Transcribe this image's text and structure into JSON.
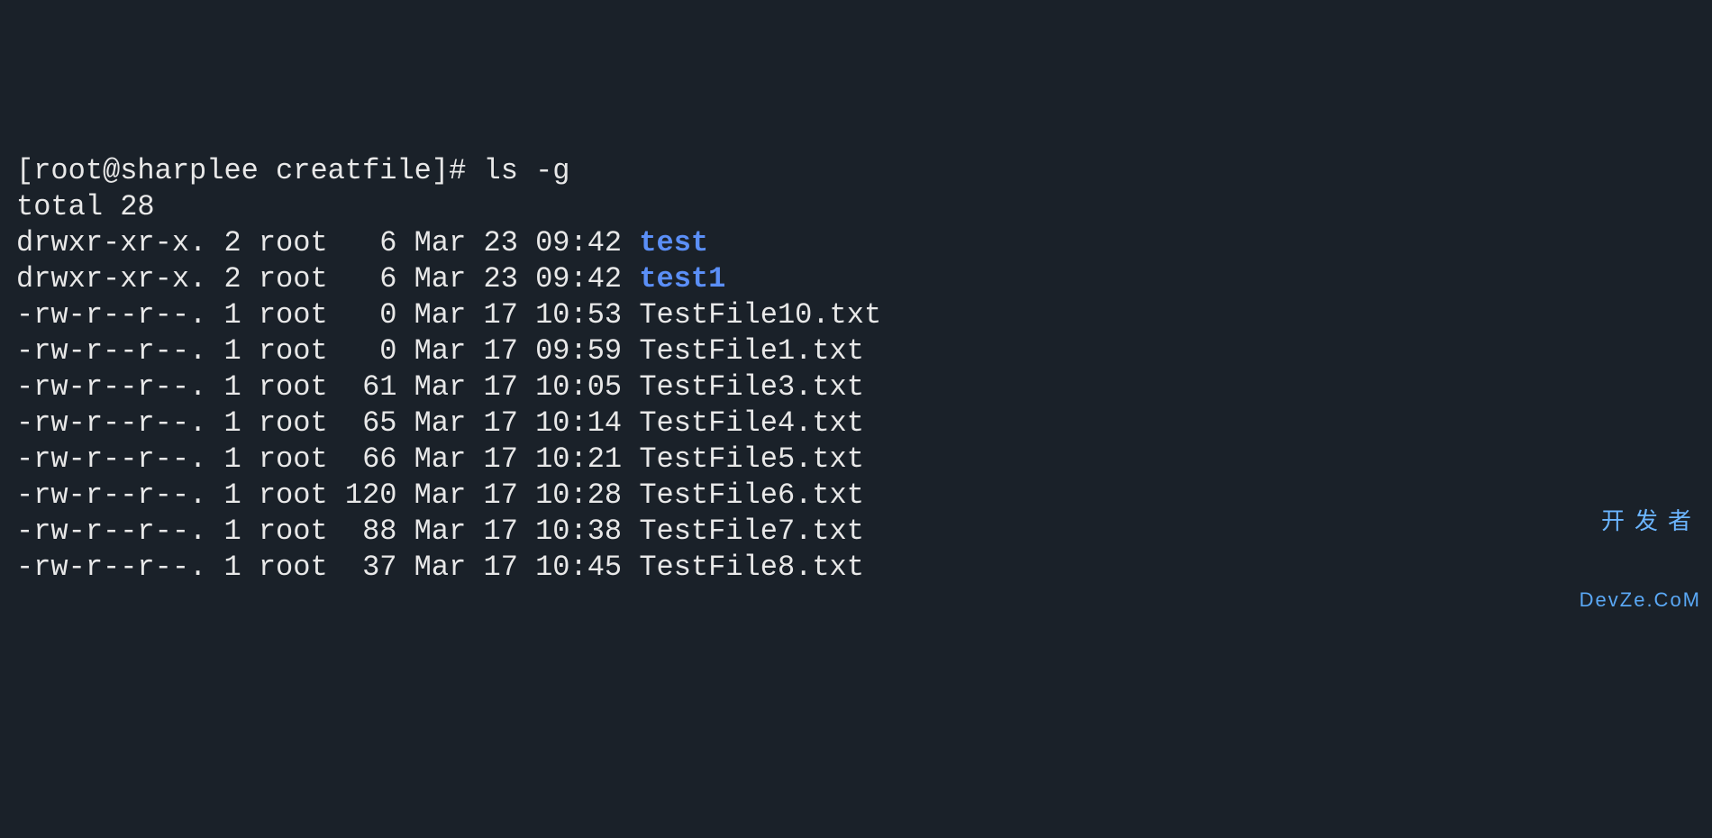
{
  "prompt": {
    "user_host": "root@sharplee",
    "cwd": "creatfile",
    "symbol": "#",
    "command": "ls -g"
  },
  "total_line": "total 28",
  "entries": [
    {
      "perms": "drwxr-xr-x.",
      "links": "2",
      "group": "root",
      "size": "6",
      "month": "Mar",
      "day": "23",
      "time": "09:42",
      "name": "test",
      "type": "dir"
    },
    {
      "perms": "drwxr-xr-x.",
      "links": "2",
      "group": "root",
      "size": "6",
      "month": "Mar",
      "day": "23",
      "time": "09:42",
      "name": "test1",
      "type": "dir"
    },
    {
      "perms": "-rw-r--r--.",
      "links": "1",
      "group": "root",
      "size": "0",
      "month": "Mar",
      "day": "17",
      "time": "10:53",
      "name": "TestFile10.txt",
      "type": "file"
    },
    {
      "perms": "-rw-r--r--.",
      "links": "1",
      "group": "root",
      "size": "0",
      "month": "Mar",
      "day": "17",
      "time": "09:59",
      "name": "TestFile1.txt",
      "type": "file"
    },
    {
      "perms": "-rw-r--r--.",
      "links": "1",
      "group": "root",
      "size": "61",
      "month": "Mar",
      "day": "17",
      "time": "10:05",
      "name": "TestFile3.txt",
      "type": "file"
    },
    {
      "perms": "-rw-r--r--.",
      "links": "1",
      "group": "root",
      "size": "65",
      "month": "Mar",
      "day": "17",
      "time": "10:14",
      "name": "TestFile4.txt",
      "type": "file"
    },
    {
      "perms": "-rw-r--r--.",
      "links": "1",
      "group": "root",
      "size": "66",
      "month": "Mar",
      "day": "17",
      "time": "10:21",
      "name": "TestFile5.txt",
      "type": "file"
    },
    {
      "perms": "-rw-r--r--.",
      "links": "1",
      "group": "root",
      "size": "120",
      "month": "Mar",
      "day": "17",
      "time": "10:28",
      "name": "TestFile6.txt",
      "type": "file"
    },
    {
      "perms": "-rw-r--r--.",
      "links": "1",
      "group": "root",
      "size": "88",
      "month": "Mar",
      "day": "17",
      "time": "10:38",
      "name": "TestFile7.txt",
      "type": "file"
    },
    {
      "perms": "-rw-r--r--.",
      "links": "1",
      "group": "root",
      "size": "37",
      "month": "Mar",
      "day": "17",
      "time": "10:45",
      "name": "TestFile8.txt",
      "type": "file"
    }
  ],
  "watermark": {
    "line1": "开发者",
    "line2": "DevZe.CoM"
  },
  "colors": {
    "background": "#1a2129",
    "text": "#e8e8e8",
    "directory": "#5b8ff7",
    "watermark": "#6bb5ff"
  }
}
